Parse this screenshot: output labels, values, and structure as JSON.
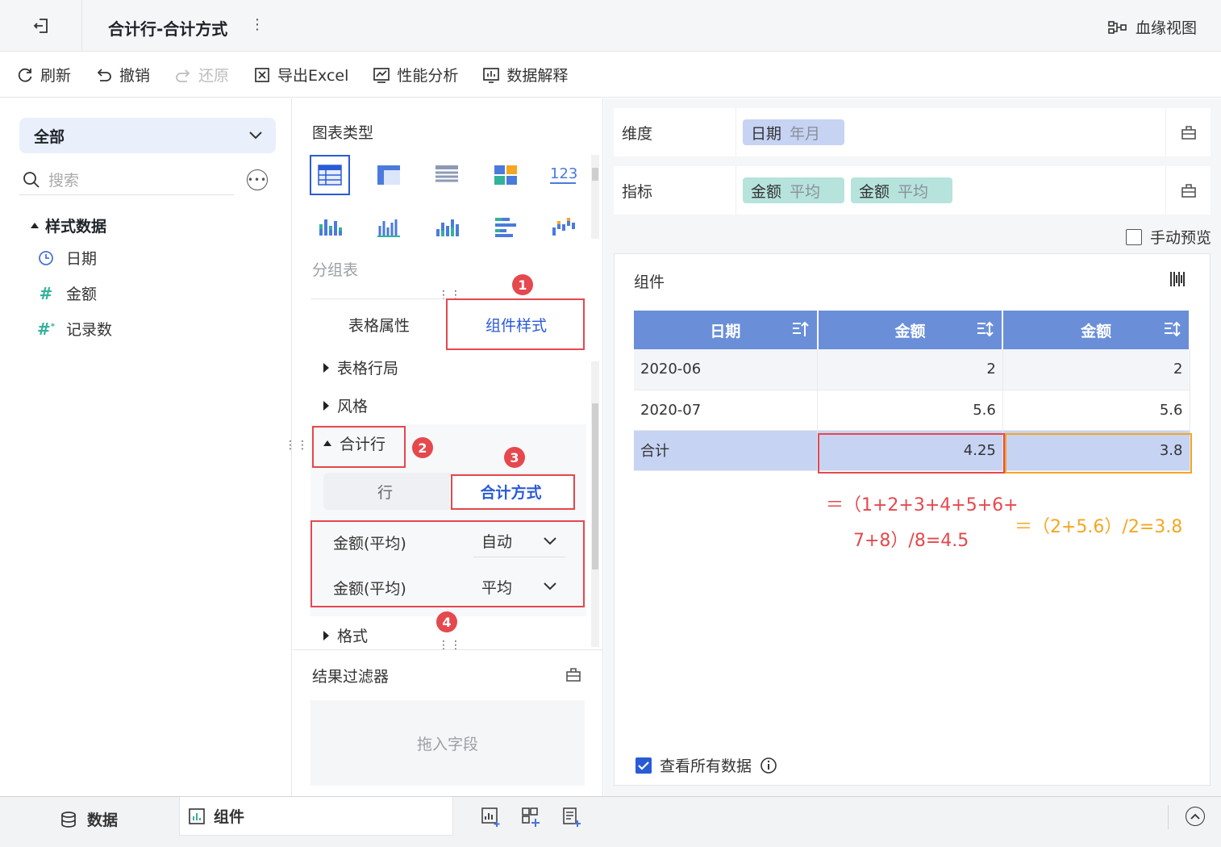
{
  "header": {
    "title": "合计行-合计方式",
    "lineage_label": "血缘视图"
  },
  "toolbar": {
    "refresh": "刷新",
    "undo": "撤销",
    "redo": "还原",
    "export": "导出Excel",
    "perf": "性能分析",
    "explain": "数据解释"
  },
  "left": {
    "scope": "全部",
    "search_placeholder": "搜索",
    "tree_root": "样式数据",
    "fields": [
      {
        "name": "日期",
        "icon": "clock-icon"
      },
      {
        "name": "金额",
        "icon": "hash-icon"
      },
      {
        "name": "记录数",
        "icon": "hash-star-icon"
      }
    ]
  },
  "middle": {
    "chart_type_title": "图表类型",
    "chart_type_name": "分组表",
    "tabs": [
      "表格属性",
      "组件样式"
    ],
    "sections": [
      "表格行局",
      "风格",
      "合计行",
      "格式"
    ],
    "segment": [
      "行",
      "合计方式"
    ],
    "rows": [
      {
        "field": "金额(平均)",
        "value": "自动"
      },
      {
        "field": "金额(平均)",
        "value": "平均"
      }
    ],
    "filter_title": "结果过滤器",
    "drop_hint": "拖入字段"
  },
  "right": {
    "dimension_label": "维度",
    "measure_label": "指标",
    "dimension_chip": {
      "name": "日期",
      "agg": "年月"
    },
    "measure_chips": [
      {
        "name": "金额",
        "agg": "平均"
      },
      {
        "name": "金额",
        "agg": "平均"
      }
    ],
    "manual_preview": "手动预览",
    "widget_title": "组件",
    "table": {
      "headers": [
        "日期",
        "金额",
        "金额"
      ],
      "rows": [
        [
          "2020-06",
          "2",
          "2"
        ],
        [
          "2020-07",
          "5.6",
          "5.6"
        ]
      ],
      "total": [
        "合计",
        "4.25",
        "3.8"
      ]
    },
    "formula_red_1": "＝（1+2+3+4+5+6+",
    "formula_red_2": "7+8）/8=4.5",
    "formula_orange": "＝（2+5.6）/2=3.8",
    "view_all": "查看所有数据"
  },
  "markers": [
    "1",
    "2",
    "3",
    "4"
  ],
  "bottom": {
    "data_tab": "数据",
    "widget_tab": "组件"
  },
  "colors": {
    "accent": "#2a5bd7",
    "header_bg": "#6a8fd8",
    "annotation_red": "#e5484d",
    "annotation_orange": "#f5a623"
  }
}
